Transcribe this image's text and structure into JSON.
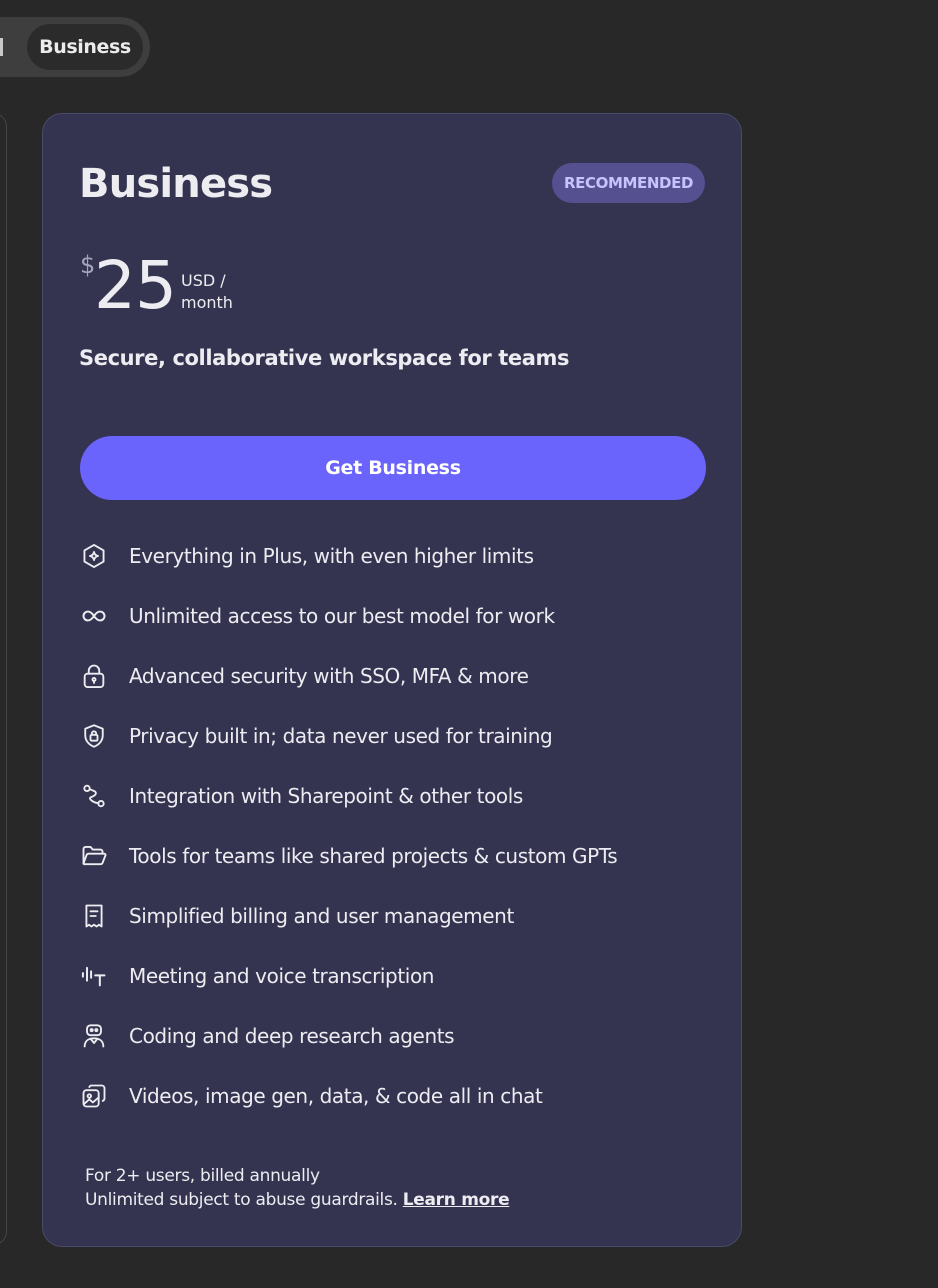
{
  "toggle": {
    "active_label": "Business"
  },
  "card": {
    "title": "Business",
    "badge": "RECOMMENDED",
    "price": {
      "currency_symbol": "$",
      "amount": "25",
      "unit_line1": "USD /",
      "unit_line2": "month"
    },
    "tagline": "Secure, collaborative workspace for teams",
    "cta_label": "Get Business",
    "features": [
      {
        "icon": "sparkle-hexagon-icon",
        "label": "Everything in Plus, with even higher limits"
      },
      {
        "icon": "infinity-icon",
        "label": "Unlimited access to our best model for work"
      },
      {
        "icon": "lock-icon",
        "label": "Advanced security with SSO, MFA & more"
      },
      {
        "icon": "shield-lock-icon",
        "label": "Privacy built in; data never used for training"
      },
      {
        "icon": "integration-icon",
        "label": "Integration with Sharepoint & other tools"
      },
      {
        "icon": "folder-icon",
        "label": "Tools for teams like shared projects & custom GPTs"
      },
      {
        "icon": "receipt-icon",
        "label": "Simplified billing and user management"
      },
      {
        "icon": "transcription-icon",
        "label": "Meeting and voice transcription"
      },
      {
        "icon": "robot-icon",
        "label": "Coding and deep research agents"
      },
      {
        "icon": "media-icon",
        "label": "Videos, image gen, data, & code all in chat"
      }
    ],
    "footer": {
      "line1": "For 2+ users, billed annually",
      "line2": "Unlimited subject to abuse guardrails.",
      "link_label": "Learn more"
    }
  },
  "colors": {
    "background": "#282828",
    "card_bg": "#353450",
    "accent": "#6a63fc",
    "badge_bg": "#55508f",
    "badge_text": "#c6c3ff"
  }
}
